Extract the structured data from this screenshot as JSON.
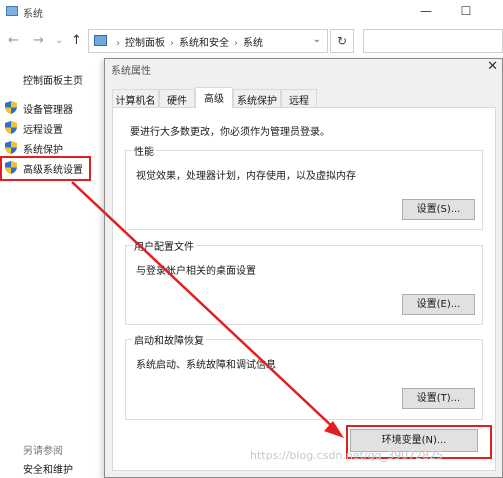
{
  "window": {
    "title": "系统",
    "controls": {
      "minimize": "—",
      "maximize": "☐"
    }
  },
  "addressbar": {
    "crumbs": [
      "控制面板",
      "系统和安全",
      "系统"
    ],
    "separator": "›",
    "dropdown": "⌄",
    "refresh": "↻",
    "nav_back": "←",
    "nav_forward": "→",
    "nav_recent": "⌄",
    "nav_up": "↑"
  },
  "leftnav": {
    "home": "控制面板主页",
    "items": [
      {
        "label": "设备管理器"
      },
      {
        "label": "远程设置"
      },
      {
        "label": "系统保护"
      },
      {
        "label": "高级系统设置"
      }
    ],
    "see_also_header": "另请参阅",
    "see_also_link": "安全和维护"
  },
  "dialog": {
    "title": "系统属性",
    "close": "✕",
    "tabs": [
      "计算机名",
      "硬件",
      "高级",
      "系统保护",
      "远程"
    ],
    "active_tab": "高级",
    "admin_note": "要进行大多数更改，你必须作为管理员登录。",
    "groups": {
      "performance": {
        "title": "性能",
        "desc": "视觉效果，处理器计划，内存使用，以及虚拟内存",
        "button": "设置(S)..."
      },
      "user_profiles": {
        "title": "用户配置文件",
        "desc": "与登录帐户相关的桌面设置",
        "button": "设置(E)..."
      },
      "startup_recovery": {
        "title": "启动和故障恢复",
        "desc": "系统启动、系统故障和调试信息",
        "button": "设置(T)..."
      }
    },
    "env_button": "环境变量(N)..."
  },
  "annotation": {
    "color": "#e02020"
  },
  "watermark": "https://blog.csdn.net/qq_39072825"
}
